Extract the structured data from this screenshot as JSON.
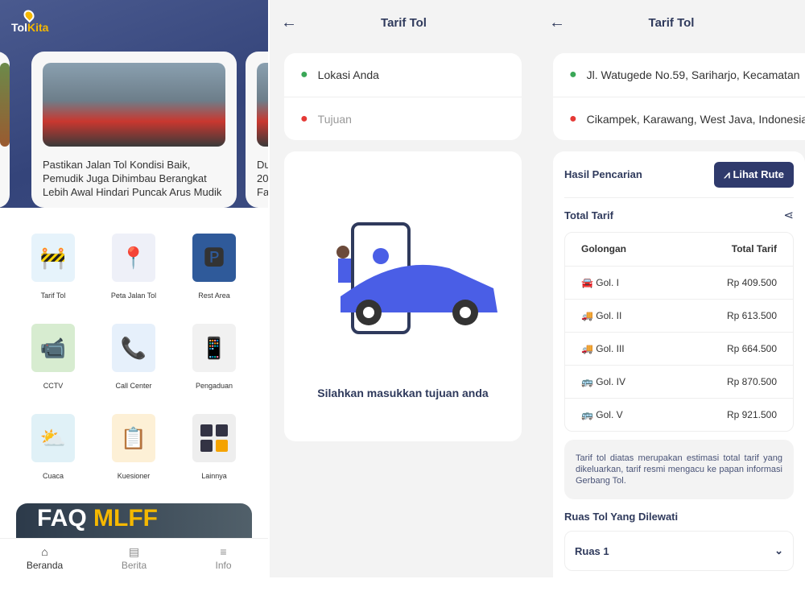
{
  "home": {
    "logo_text": "TolKita",
    "news": [
      {
        "title": ""
      },
      {
        "title": "Pastikan Jalan Tol Kondisi Baik, Pemudik Juga Dihimbau Berangkat Lebih Awal Hindari Puncak Arus Mudik"
      },
      {
        "title": "Du 20 Fa"
      }
    ],
    "menu": [
      {
        "label": "Tarif Tol",
        "icon": "toll-gate-icon"
      },
      {
        "label": "Peta Jalan Tol",
        "icon": "map-icon"
      },
      {
        "label": "Rest Area",
        "icon": "rest-area-icon"
      },
      {
        "label": "CCTV",
        "icon": "cctv-icon"
      },
      {
        "label": "Call Center",
        "icon": "call-center-icon"
      },
      {
        "label": "Pengaduan",
        "icon": "complaint-icon"
      },
      {
        "label": "Cuaca",
        "icon": "weather-icon"
      },
      {
        "label": "Kuesioner",
        "icon": "questionnaire-icon"
      },
      {
        "label": "Lainnya",
        "icon": "more-icon"
      }
    ],
    "banner": {
      "a": "FAQ",
      "b": "MLFF"
    },
    "nav": [
      {
        "label": "Beranda",
        "icon": "home-icon"
      },
      {
        "label": "Berita",
        "icon": "news-icon"
      },
      {
        "label": "Info",
        "icon": "menu-icon"
      }
    ]
  },
  "tarif_empty": {
    "title": "Tarif Tol",
    "origin": "Lokasi Anda",
    "destination_placeholder": "Tujuan",
    "message": "Silahkan masukkan tujuan anda"
  },
  "tarif_result": {
    "title": "Tarif Tol",
    "origin": "Jl. Watugede No.59, Sariharjo, Kecamatan",
    "destination": "Cikampek, Karawang, West Java, Indonesia",
    "results_label": "Hasil Pencarian",
    "route_button": "Lihat Rute",
    "total_label": "Total Tarif",
    "columns": [
      "Golongan",
      "Total Tarif"
    ],
    "rows": [
      {
        "class": "Gol. I",
        "price": "Rp 409.500",
        "icon": "car-icon"
      },
      {
        "class": "Gol. II",
        "price": "Rp 613.500",
        "icon": "truck-icon"
      },
      {
        "class": "Gol. III",
        "price": "Rp 664.500",
        "icon": "truck-icon"
      },
      {
        "class": "Gol. IV",
        "price": "Rp 870.500",
        "icon": "bus-icon"
      },
      {
        "class": "Gol. V",
        "price": "Rp 921.500",
        "icon": "bus-icon"
      }
    ],
    "note": "Tarif tol diatas merupakan estimasi total tarif yang dikeluarkan, tarif resmi mengacu ke papan informasi Gerbang Tol.",
    "segments_label": "Ruas Tol Yang Dilewati",
    "segment": "Ruas 1"
  },
  "colors": {
    "navy": "#2f3a5c",
    "accent": "#f5b800",
    "pin_green": "#3aa757",
    "pin_red": "#e53935"
  }
}
